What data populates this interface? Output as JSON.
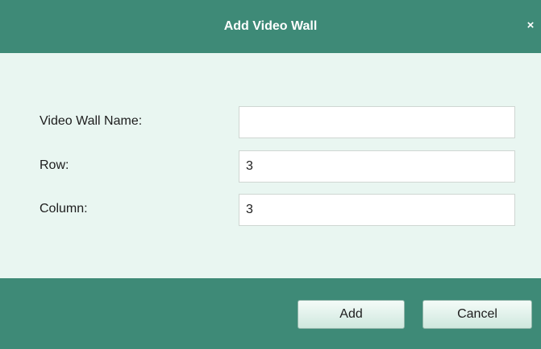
{
  "dialog": {
    "title": "Add Video Wall",
    "close_symbol": "×"
  },
  "form": {
    "name": {
      "label": "Video Wall Name:",
      "value": ""
    },
    "row": {
      "label": "Row:",
      "value": "3"
    },
    "column": {
      "label": "Column:",
      "value": "3"
    }
  },
  "buttons": {
    "add_label": "Add",
    "cancel_label": "Cancel"
  },
  "colors": {
    "title_bar": "#3e8a77",
    "body_background": "#e9f6f1",
    "footer": "#3e8a77"
  },
  "icons": {
    "close": "close-icon"
  }
}
